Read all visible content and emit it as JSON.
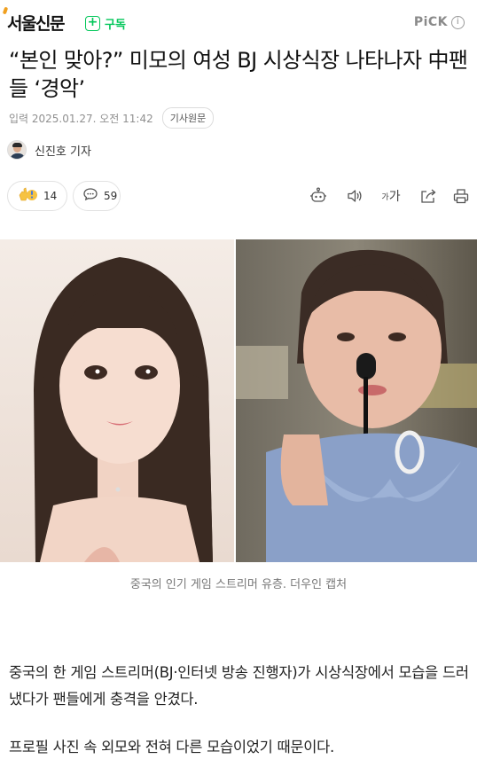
{
  "header": {
    "press_name": "서울신문",
    "subscribe_label": "구독",
    "pick_label": "PiCK",
    "info_icon": "info-icon"
  },
  "article": {
    "headline": "“본인 맞아?” 미모의 여성 BJ 시상식장 나타나자 中팬들 ‘경악’",
    "date": "입력 2025.01.27. 오전 11:42",
    "original_button": "기사원문",
    "reporter": "신진호 기자"
  },
  "actions": {
    "reaction_count": "14",
    "comment_count": "59",
    "icons": [
      "reaction-emoji-icon",
      "comment-icon",
      "summary-bot-icon",
      "speaker-icon",
      "font-size-icon",
      "share-icon",
      "print-icon"
    ],
    "font_size_label": "가"
  },
  "photo": {
    "caption": "중국의 인기 게임 스트리머 유층. 더우인 캡처"
  },
  "body": {
    "paragraph_1": "중국의 한 게임 스트리머(BJ·인터넷 방송 진행자)가 시상식장에서 모습을 드러냈다가 팬들에게 충격을 안겼다.",
    "paragraph_2": "프로필 사진 속 외모와 전혀 다른 모습이었기 때문이다."
  },
  "colors": {
    "accent_green": "#03c75a",
    "muted_text": "#909090"
  }
}
